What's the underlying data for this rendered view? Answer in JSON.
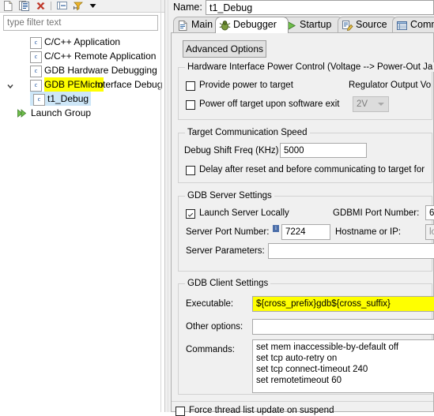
{
  "left_panel": {
    "toolbar": {
      "icons": [
        "new-launch-configuration-icon",
        "duplicate-icon",
        "delete-icon",
        "collapse-all-icon",
        "filter-icon",
        "view-menu-icon"
      ]
    },
    "filter": {
      "placeholder": "type filter text",
      "value": ""
    },
    "tree": [
      {
        "label": "C/C++ Application",
        "icon": "c-file-icon",
        "indent": 0,
        "state": "normal"
      },
      {
        "label": "C/C++ Remote Application",
        "icon": "c-file-icon",
        "indent": 0,
        "state": "normal"
      },
      {
        "label": "GDB Hardware Debugging",
        "icon": "c-file-icon",
        "indent": 0,
        "state": "normal"
      },
      {
        "label": "GDB PEMicro Interface Debug",
        "highlight_text": "GDB PEMicro",
        "rest_text": " Interface Debug",
        "icon": "c-file-icon",
        "indent": 0,
        "state": "highlighted",
        "expanded": true
      },
      {
        "label": "t1_Debug",
        "icon": "c-file-icon",
        "indent": 1,
        "state": "selected"
      },
      {
        "label": "Launch Group",
        "icon": "launch-group-icon",
        "indent": 0,
        "state": "normal"
      }
    ]
  },
  "right_panel": {
    "name_label": "Name:",
    "name_value": "t1_Debug",
    "tabs": [
      {
        "label": "Main",
        "icon": "document-icon",
        "active": false
      },
      {
        "label": "Debugger",
        "icon": "bug-icon",
        "active": true
      },
      {
        "label": "Startup",
        "icon": "play-icon",
        "active": false
      },
      {
        "label": "Source",
        "icon": "source-edit-icon",
        "active": false
      },
      {
        "label": "Comm",
        "icon": "table-icon",
        "active": false
      }
    ],
    "advanced_options_button": "Advanced Options",
    "groups": {
      "power": {
        "title": "Hardware Interface Power Control (Voltage --> Power-Out Ja",
        "provide_power": {
          "label": "Provide power to target",
          "checked": false
        },
        "power_off": {
          "label": "Power off target upon software exit",
          "checked": false
        },
        "regulator_label": "Regulator Output Vo",
        "voltage_select": {
          "value": "2V",
          "enabled": false
        }
      },
      "comm_speed": {
        "title": "Target Communication Speed",
        "shift_freq_label": "Debug Shift Freq (KHz)",
        "shift_freq_value": "5000",
        "delay_checkbox": {
          "label": "Delay after reset and before communicating to target for",
          "checked": false
        }
      },
      "gdb_server": {
        "title": "GDB Server Settings",
        "launch_local": {
          "label": "Launch Server Locally",
          "checked": true
        },
        "gdbmi_port_label": "GDBMI Port Number:",
        "gdbmi_port_value": "6",
        "server_port_label": "Server Port Number:",
        "server_port_value": "7224",
        "server_port_badge": "i",
        "hostname_label": "Hostname or IP:",
        "hostname_value": "lo",
        "server_params_label": "Server Parameters:",
        "server_params_value": ""
      },
      "gdb_client": {
        "title": "GDB Client Settings",
        "executable_label": "Executable:",
        "executable_value": "${cross_prefix}gdb${cross_suffix}",
        "other_options_label": "Other options:",
        "other_options_value": "",
        "commands_label": "Commands:",
        "commands_value": "set mem inaccessible-by-default off\nset tcp auto-retry on\nset tcp connect-timeout 240\nset remotetimeout 60"
      }
    },
    "force_thread_update": {
      "label": "Force thread list update on suspend",
      "checked": false
    }
  },
  "colors": {
    "highlight_yellow": "#ffff00",
    "selection_blue": "#cde6f7",
    "panel_bg": "#f0f0f0",
    "group_border": "#d2d2d2"
  }
}
